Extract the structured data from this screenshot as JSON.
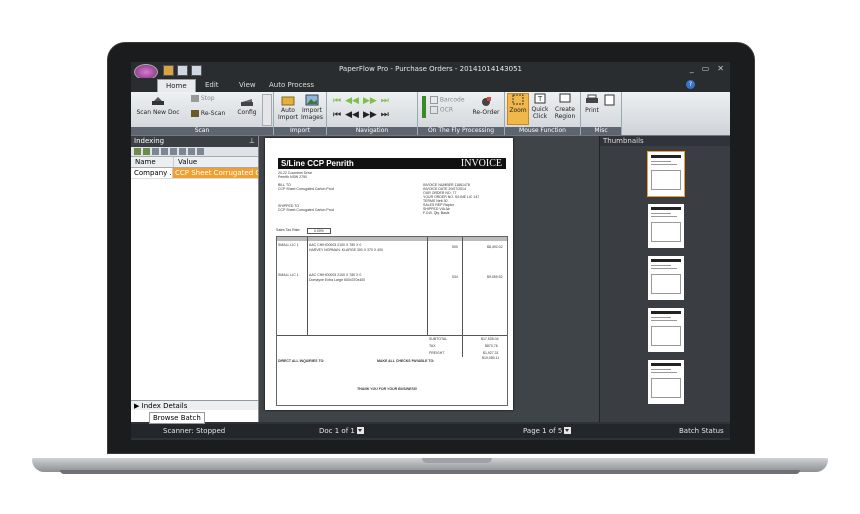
{
  "window": {
    "title": "PaperFlow Pro - Purchase Orders - 20141014143051"
  },
  "tabs": [
    {
      "label": "Home"
    },
    {
      "label": "Edit"
    },
    {
      "label": "View"
    },
    {
      "label": "Auto Process"
    }
  ],
  "ribbon": {
    "scan": {
      "label": "Scan",
      "scan_new_doc": "Scan New Doc",
      "stop": "Stop",
      "re_scan": "Re-Scan",
      "config": "Config"
    },
    "import": {
      "label": "Import",
      "auto_import": "Auto Import",
      "import_images": "Import Images"
    },
    "navigation": {
      "label": "Navigation"
    },
    "otf": {
      "label": "On The Fly Processing",
      "opt1": "Barcode",
      "opt2": "OCR",
      "re_order": "Re-Order"
    },
    "mouse": {
      "label": "Mouse Function",
      "zoom": "Zoom",
      "quick_click": "Quick Click",
      "create_region": "Create Region"
    },
    "misc": {
      "label": "Misc",
      "print": "Print"
    }
  },
  "indexing": {
    "title": "Indexing",
    "col_name": "Name",
    "col_value": "Value",
    "rows": [
      {
        "name": "Company ...",
        "value": "CCP Sheet Corrugated Cart..."
      }
    ],
    "index_details": "Index Details",
    "browse_batch": "Browse Batch"
  },
  "invoice": {
    "company": "S/Line CCP Penrith",
    "title": "INVOICE",
    "address1": "20-22 Coombes Drive",
    "address2": "Penrith NSW 2750",
    "bill_to": "BILL TO",
    "bill_name": "CCP Sheet Corrugated Carton Prod",
    "ship_to": "SHIPPED TO",
    "ship_name": "CCP Sheet Corrugated Carton Prod",
    "meta": [
      "INVOICE NUMBER 11861478",
      "INVOICE DATE 20/07/2014",
      "OUR ORDER NO. 77",
      "YOUR ORDER NO. S/LINE LIC 147",
      "TERMS Nett 30",
      "SALES REP Raptor",
      "SHIPPED VIA Air",
      "F.O.B. Qty. Basis"
    ],
    "sales_tax_label": "Sales Tax Rate:",
    "sales_tax_rate": "0.00%",
    "items": [
      {
        "code": "SMALL LIC 1",
        "desc": "AAC CHIHO0003 2100 X 780 X 0",
        "desc2": "HARVEY NORMAN: KLARGE 300 X 370 X 400",
        "qty": "500",
        "amount": "$8,492.02"
      },
      {
        "code": "SMALL LIC 1",
        "desc": "AAC CHIHO0003 2100 X 780 X 0",
        "desc2": "Domayne Extra Large 600x370x400",
        "qty": "534",
        "amount": "$9,059.52"
      }
    ],
    "subtotal_label": "SUBTOTAL",
    "subtotal": "$17,535.04",
    "tax_label": "TAX",
    "tax": "$870.76",
    "freight_label": "FREIGHT",
    "freight": "$1,927.31",
    "total": "$19,080.11",
    "inquiries": "DIRECT ALL INQUIRIES TO:",
    "checks": "MAKE ALL CHECKS PAYABLE TO:",
    "thanks": "THANK YOU FOR YOUR BUSINESS!"
  },
  "thumbnails": {
    "title": "Thumbnails",
    "count": 5
  },
  "status": {
    "scanner": "Scanner: Stopped",
    "doc": "Doc 1 of 1",
    "page": "Page 1 of 5",
    "batch": "Batch Status"
  },
  "colors": {
    "accent": "#f0a030",
    "ribbon_label": "#5d6670",
    "laptop_frame": "#1b1c1e"
  }
}
